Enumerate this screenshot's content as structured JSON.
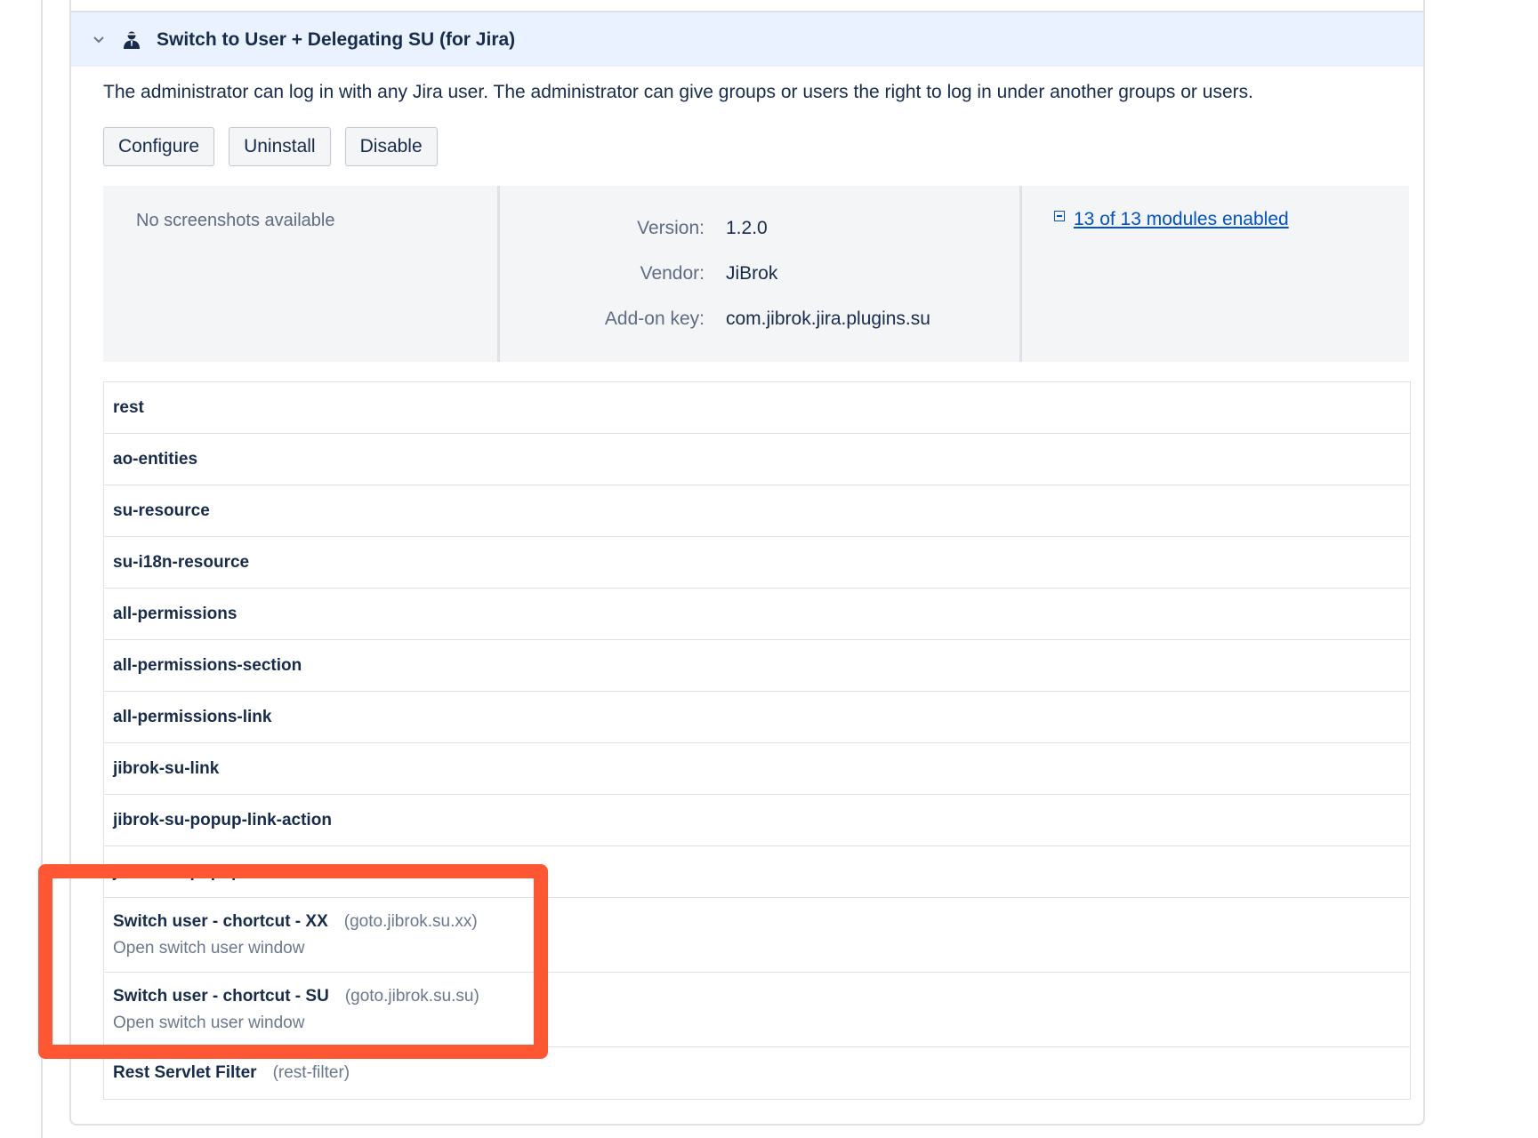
{
  "header": {
    "title": "Switch to User + Delegating SU (for Jira)",
    "icon": "agent-user-icon"
  },
  "description": "The administrator can log in with any Jira user. The administrator can give groups or users the right to log in under another groups or users.",
  "buttons": {
    "configure": "Configure",
    "uninstall": "Uninstall",
    "disable": "Disable"
  },
  "info": {
    "no_screenshots": "No screenshots available",
    "version_label": "Version:",
    "version_value": "1.2.0",
    "vendor_label": "Vendor:",
    "vendor_value": "JiBrok",
    "key_label": "Add-on key:",
    "key_value": "com.jibrok.jira.plugins.su",
    "modules_link": "13 of 13 modules enabled"
  },
  "modules": [
    {
      "name": "rest"
    },
    {
      "name": "ao-entities"
    },
    {
      "name": "su-resource"
    },
    {
      "name": "su-i18n-resource"
    },
    {
      "name": "all-permissions"
    },
    {
      "name": "all-permissions-section"
    },
    {
      "name": "all-permissions-link"
    },
    {
      "name": "jibrok-su-link"
    },
    {
      "name": "jibrok-su-popup-link-action"
    },
    {
      "name": "jibrok-su-popup-link"
    },
    {
      "name": "Switch user - chortcut - XX",
      "key": "(goto.jibrok.su.xx)",
      "desc": "Open switch user window"
    },
    {
      "name": "Switch user - chortcut - SU",
      "key": "(goto.jibrok.su.su)",
      "desc": "Open switch user window"
    },
    {
      "name": "Rest Servlet Filter",
      "key": "(rest-filter)"
    }
  ],
  "colors": {
    "highlight": "#ff5733",
    "link": "#0052cc",
    "header_bg": "#ebf2ff"
  }
}
